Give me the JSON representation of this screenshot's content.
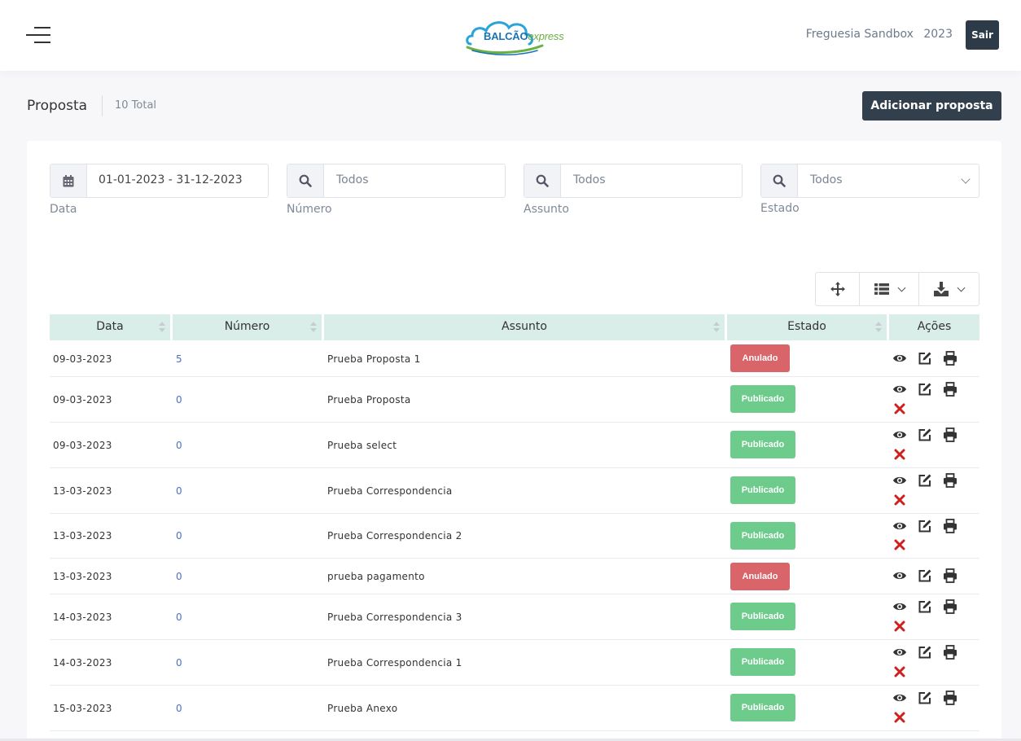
{
  "header": {
    "logo_main": "BALCÃO",
    "logo_sub": "express",
    "org_name": "Freguesia Sandbox",
    "year": "2023",
    "logout_label": "Sair"
  },
  "page": {
    "title": "Proposta",
    "total": "10 Total",
    "add_button": "Adicionar proposta"
  },
  "filters": {
    "date": {
      "value": "01-01-2023 - 31-12-2023",
      "label": "Data"
    },
    "numero": {
      "placeholder": "Todos",
      "label": "Número"
    },
    "assunto": {
      "placeholder": "Todos",
      "label": "Assunto"
    },
    "estado": {
      "selected": "Todos",
      "label": "Estado"
    }
  },
  "toolbar": {
    "icons": [
      "move-icon",
      "list-icon",
      "download-icon"
    ]
  },
  "table": {
    "columns": [
      "Data",
      "Número",
      "Assunto",
      "Estado",
      "Ações"
    ],
    "rows": [
      {
        "data": "09-03-2023",
        "numero": "5",
        "assunto": "Prueba Proposta 1",
        "estado": "Anulado",
        "deletable": false
      },
      {
        "data": "09-03-2023",
        "numero": "0",
        "assunto": "Prueba Proposta",
        "estado": "Publicado",
        "deletable": true
      },
      {
        "data": "09-03-2023",
        "numero": "0",
        "assunto": "Prueba select",
        "estado": "Publicado",
        "deletable": true
      },
      {
        "data": "13-03-2023",
        "numero": "0",
        "assunto": "Prueba Correspondencia",
        "estado": "Publicado",
        "deletable": true
      },
      {
        "data": "13-03-2023",
        "numero": "0",
        "assunto": "Prueba Correspondencia 2",
        "estado": "Publicado",
        "deletable": true
      },
      {
        "data": "13-03-2023",
        "numero": "0",
        "assunto": "prueba pagamento",
        "estado": "Anulado",
        "deletable": false
      },
      {
        "data": "14-03-2023",
        "numero": "0",
        "assunto": "Prueba Correspondencia 3",
        "estado": "Publicado",
        "deletable": true
      },
      {
        "data": "14-03-2023",
        "numero": "0",
        "assunto": "Prueba Correspondencia 1",
        "estado": "Publicado",
        "deletable": true
      },
      {
        "data": "15-03-2023",
        "numero": "0",
        "assunto": "Prueba Anexo",
        "estado": "Publicado",
        "deletable": true
      }
    ]
  },
  "colors": {
    "anulado": "#d9646a",
    "publicado": "#6dcb8c",
    "header_bg": "#d9ede9",
    "dark_button": "#323f4c",
    "link": "#4a6fc7"
  }
}
